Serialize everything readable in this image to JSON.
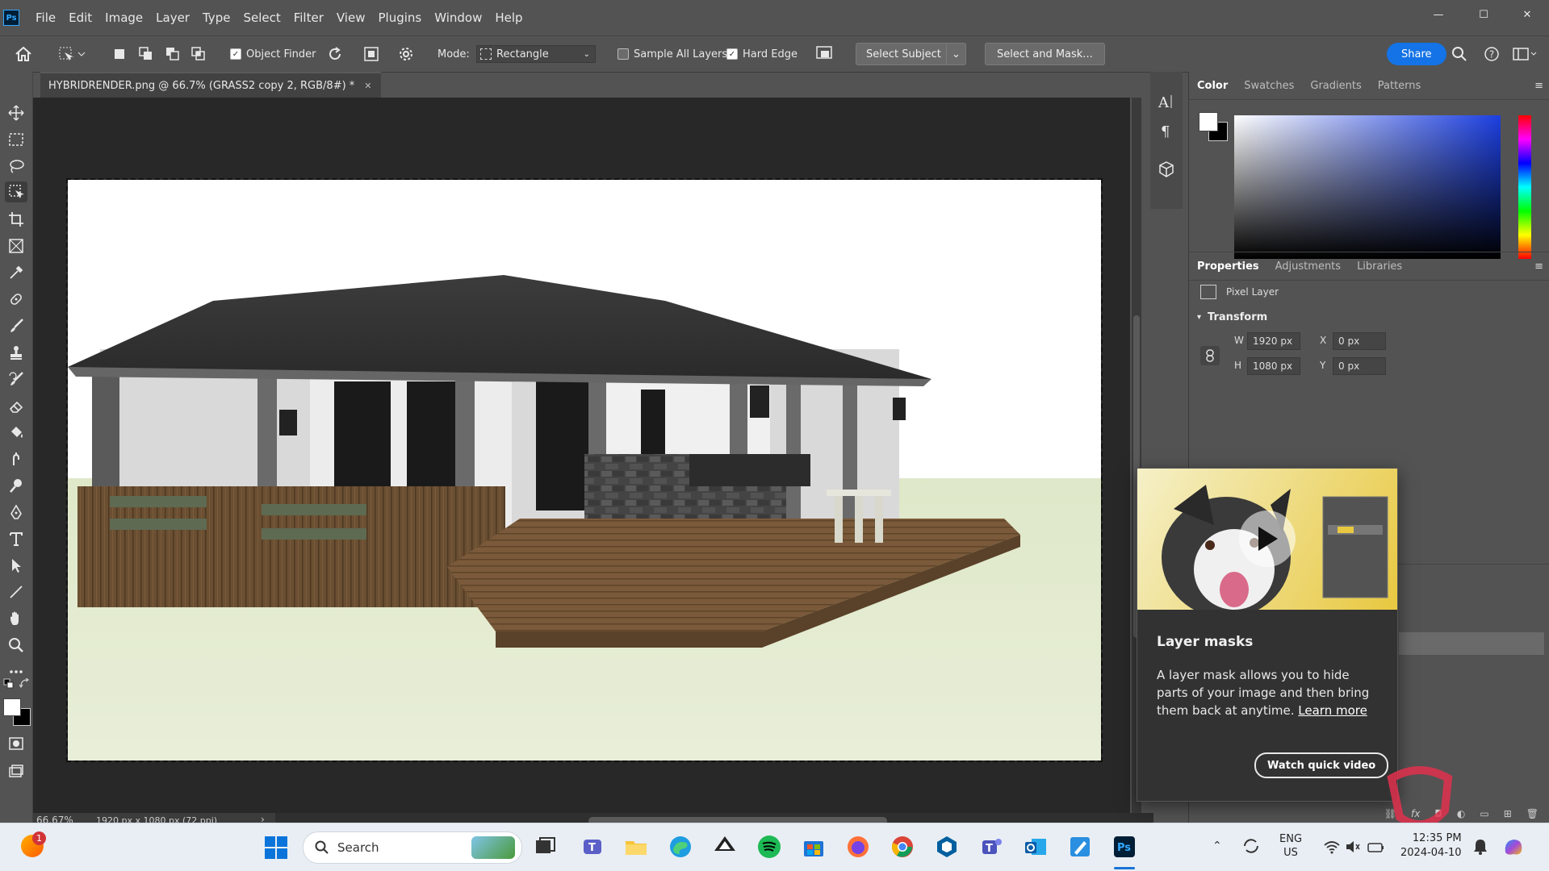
{
  "app": {
    "logo": "Ps"
  },
  "menu": [
    "File",
    "Edit",
    "Image",
    "Layer",
    "Type",
    "Select",
    "Filter",
    "View",
    "Plugins",
    "Window",
    "Help"
  ],
  "window_controls": {
    "minimize": "—",
    "maximize": "☐",
    "close": "✕"
  },
  "options_bar": {
    "object_finder": "Object Finder",
    "mode_label": "Mode:",
    "mode_value": "Rectangle",
    "sample_all_layers": "Sample All Layers",
    "hard_edge": "Hard Edge",
    "select_subject": "Select Subject",
    "select_and_mask": "Select and Mask...",
    "share": "Share",
    "object_finder_checked": true,
    "sample_all_layers_checked": false,
    "hard_edge_checked": true
  },
  "document": {
    "tab_title": "HYBRIDRENDER.png @ 66.7% (GRASS2 copy 2, RGB/8#) *",
    "close": "✕"
  },
  "status": {
    "zoom": "66.67%",
    "info": "1920 px x 1080 px (72 ppi)"
  },
  "color_panel": {
    "tabs": [
      "Color",
      "Swatches",
      "Gradients",
      "Patterns"
    ],
    "active": "Color"
  },
  "properties_panel": {
    "tabs": [
      "Properties",
      "Adjustments",
      "Libraries"
    ],
    "active": "Properties",
    "layer_type": "Pixel Layer",
    "section": "Transform",
    "w_label": "W",
    "w_value": "1920 px",
    "h_label": "H",
    "h_value": "1080 px",
    "x_label": "X",
    "x_value": "0 px",
    "y_label": "Y",
    "y_value": "0 px"
  },
  "popup": {
    "title": "Layer masks",
    "body": "A layer mask allows you to hide parts of your image and then bring them back at anytime.",
    "link": "Learn more",
    "button": "Watch quick video"
  },
  "taskbar": {
    "search": "Search",
    "notification_count": "1",
    "lang1": "ENG",
    "lang2": "US",
    "time": "12:35 PM",
    "date": "2024-04-10"
  },
  "colors": {
    "accent": "#1473e6",
    "bg": "#535353",
    "workspace": "#282828"
  }
}
